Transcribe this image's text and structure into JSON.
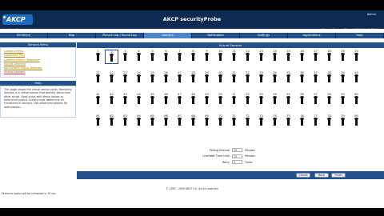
{
  "header": {
    "logo": "AKCP",
    "title": "AKCP securityProbe",
    "admin": "Admin",
    "location": "Location: System Location",
    "system_time": "Current System Time: 2009/9/9 13:55:44"
  },
  "tabs": [
    {
      "label": "Summary"
    },
    {
      "label": "Map"
    },
    {
      "label": "Picture Log / Sound Log"
    },
    {
      "label": "Sensors"
    },
    {
      "label": "Notification"
    },
    {
      "label": "Settings"
    },
    {
      "label": "Applications"
    },
    {
      "label": "Help"
    }
  ],
  "sidebar": {
    "menu_title": "Sensors Menu",
    "items": [
      {
        "label": "Camera Menu"
      },
      {
        "label": "Expansion Port"
      },
      {
        "label": "Camera Motion Detection"
      },
      {
        "label": "Sound Detector"
      },
      {
        "label": "No Camera Signal Detector"
      },
      {
        "label": "Virtual Sensors"
      }
    ],
    "help_title": "Help",
    "help_text": "This page shows the virtual sensor ports. Remotely Sensors is a virtual sensor that directly value from other script. Used script with these values to determine output. Scripts must determine on transitions in sensors. Use advanced options for optimization."
  },
  "main": {
    "title": "Virtual Sensors",
    "sensor_rows": [
      [
        "1",
        "2",
        "3",
        "4",
        "5",
        "6",
        "7",
        "8",
        "9",
        "10",
        "11",
        "12",
        "13",
        "14",
        "15",
        "16",
        "17",
        "18",
        "19",
        "20"
      ],
      [
        "21",
        "22",
        "23",
        "24",
        "25",
        "26",
        "27",
        "28",
        "29",
        "30",
        "31",
        "32",
        "33",
        "34",
        "35",
        "36",
        "37",
        "38",
        "39",
        "40"
      ],
      [
        "41",
        "42",
        "43",
        "44",
        "45",
        "46",
        "47",
        "48",
        "49",
        "50",
        "51",
        "52",
        "53",
        "54",
        "55",
        "56",
        "57",
        "58",
        "59",
        "60"
      ],
      [
        "61",
        "62",
        "63",
        "64",
        "65",
        "66",
        "67",
        "68",
        "69",
        "70",
        "71",
        "72",
        "73",
        "74",
        "75",
        "76",
        "77",
        "78",
        "79",
        "80"
      ]
    ],
    "selected_sensor": "2",
    "form": {
      "polling_label": "Polling Interval",
      "polling_value": "10",
      "polling_unit": "Minutes",
      "live_label": "Live/Wait Time Until",
      "live_value": "10",
      "live_unit": "Minutes",
      "retry_label": "Retry",
      "retry_value": "3",
      "retry_unit": "Times"
    },
    "buttons": {
      "cancel": "Cancel",
      "back": "Back",
      "finish": "Finish"
    }
  },
  "footer": {
    "copyright": "© 1997 - 2009 AKCP Co. Ltd All reserved",
    "note": "Performs status will be refreshed in 30 sec."
  }
}
